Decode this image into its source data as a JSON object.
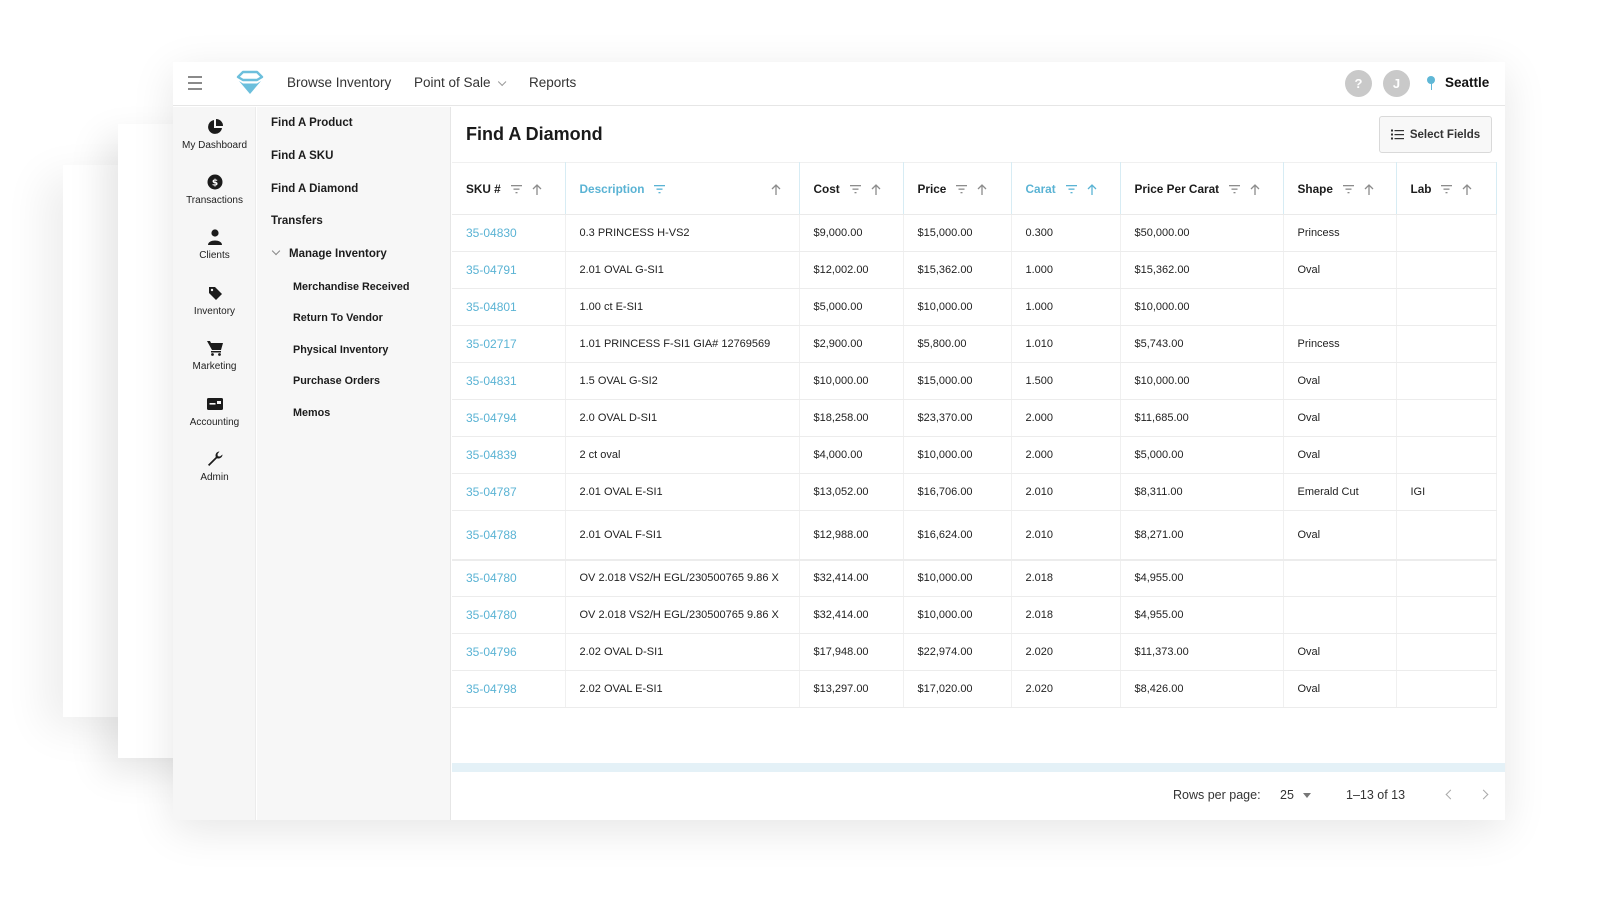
{
  "topbar": {
    "nav": [
      {
        "label": "Browse Inventory",
        "has_dropdown": false
      },
      {
        "label": "Point of Sale",
        "has_dropdown": true
      },
      {
        "label": "Reports",
        "has_dropdown": false
      }
    ],
    "help_label": "?",
    "user_initial": "J",
    "location": "Seattle",
    "accent_color": "#5ab3d4"
  },
  "rail": [
    {
      "label": "My Dashboard",
      "icon": "pie-chart-icon"
    },
    {
      "label": "Transactions",
      "icon": "dollar-badge-icon"
    },
    {
      "label": "Clients",
      "icon": "person-icon"
    },
    {
      "label": "Inventory",
      "icon": "tag-icon"
    },
    {
      "label": "Marketing",
      "icon": "cart-icon"
    },
    {
      "label": "Accounting",
      "icon": "card-icon"
    },
    {
      "label": "Admin",
      "icon": "wrench-icon"
    }
  ],
  "subnav": {
    "items": [
      "Find A Product",
      "Find A SKU",
      "Find A Diamond",
      "Transfers"
    ],
    "group": {
      "label": "Manage Inventory",
      "expanded": true,
      "children": [
        "Merchandise Received",
        "Return To Vendor",
        "Physical Inventory",
        "Purchase Orders",
        "Memos"
      ]
    }
  },
  "main": {
    "title": "Find A Diamond",
    "select_fields_label": "Select Fields",
    "columns": [
      {
        "label": "SKU #",
        "active": false
      },
      {
        "label": "Description",
        "active": true
      },
      {
        "label": "Cost",
        "active": false
      },
      {
        "label": "Price",
        "active": false
      },
      {
        "label": "Carat",
        "active": true
      },
      {
        "label": "Price Per Carat",
        "active": false
      },
      {
        "label": "Shape",
        "active": false
      },
      {
        "label": "Lab",
        "active": false
      }
    ],
    "rows": [
      {
        "sku": "35-04830",
        "description": "0.3 PRINCESS H-VS2",
        "cost": "$9,000.00",
        "price": "$15,000.00",
        "carat": "0.300",
        "ppc": "$50,000.00",
        "shape": "Princess",
        "lab": ""
      },
      {
        "sku": "35-04791",
        "description": "2.01 OVAL G-SI1",
        "cost": "$12,002.00",
        "price": "$15,362.00",
        "carat": "1.000",
        "ppc": "$15,362.00",
        "shape": "Oval",
        "lab": ""
      },
      {
        "sku": "35-04801",
        "description": "1.00 ct E-SI1",
        "cost": "$5,000.00",
        "price": "$10,000.00",
        "carat": "1.000",
        "ppc": "$10,000.00",
        "shape": "",
        "lab": ""
      },
      {
        "sku": "35-02717",
        "description": "1.01 PRINCESS F-SI1 GIA# 12769569",
        "cost": "$2,900.00",
        "price": "$5,800.00",
        "carat": "1.010",
        "ppc": "$5,743.00",
        "shape": "Princess",
        "lab": ""
      },
      {
        "sku": "35-04831",
        "description": "1.5 OVAL G-SI2",
        "cost": "$10,000.00",
        "price": "$15,000.00",
        "carat": "1.500",
        "ppc": "$10,000.00",
        "shape": "Oval",
        "lab": ""
      },
      {
        "sku": "35-04794",
        "description": "2.0 OVAL D-SI1",
        "cost": "$18,258.00",
        "price": "$23,370.00",
        "carat": "2.000",
        "ppc": "$11,685.00",
        "shape": "Oval",
        "lab": ""
      },
      {
        "sku": "35-04839",
        "description": "2 ct oval",
        "cost": "$4,000.00",
        "price": "$10,000.00",
        "carat": "2.000",
        "ppc": "$5,000.00",
        "shape": "Oval",
        "lab": ""
      },
      {
        "sku": "35-04787",
        "description": "2.01 OVAL E-SI1",
        "cost": "$13,052.00",
        "price": "$16,706.00",
        "carat": "2.010",
        "ppc": "$8,311.00",
        "shape": "Emerald Cut",
        "lab": "IGI"
      },
      {
        "sku": "35-04788",
        "description": "2.01 OVAL F-SI1",
        "cost": "$12,988.00",
        "price": "$16,624.00",
        "carat": "2.010",
        "ppc": "$8,271.00",
        "shape": "Oval",
        "lab": ""
      },
      {
        "sku": "35-04780",
        "description": "OV 2.018 VS2/H EGL/230500765 9.86 X",
        "cost": "$32,414.00",
        "price": "$10,000.00",
        "carat": "2.018",
        "ppc": "$4,955.00",
        "shape": "",
        "lab": ""
      },
      {
        "sku": "35-04780",
        "description": "OV 2.018 VS2/H EGL/230500765 9.86 X",
        "cost": "$32,414.00",
        "price": "$10,000.00",
        "carat": "2.018",
        "ppc": "$4,955.00",
        "shape": "",
        "lab": ""
      },
      {
        "sku": "35-04796",
        "description": "2.02 OVAL D-SI1",
        "cost": "$17,948.00",
        "price": "$22,974.00",
        "carat": "2.020",
        "ppc": "$11,373.00",
        "shape": "Oval",
        "lab": ""
      },
      {
        "sku": "35-04798",
        "description": "2.02 OVAL E-SI1",
        "cost": "$13,297.00",
        "price": "$17,020.00",
        "carat": "2.020",
        "ppc": "$8,426.00",
        "shape": "Oval",
        "lab": ""
      }
    ],
    "pagination": {
      "rows_per_page_label": "Rows per page:",
      "rows_per_page": "25",
      "range": "1–13 of 13"
    }
  }
}
